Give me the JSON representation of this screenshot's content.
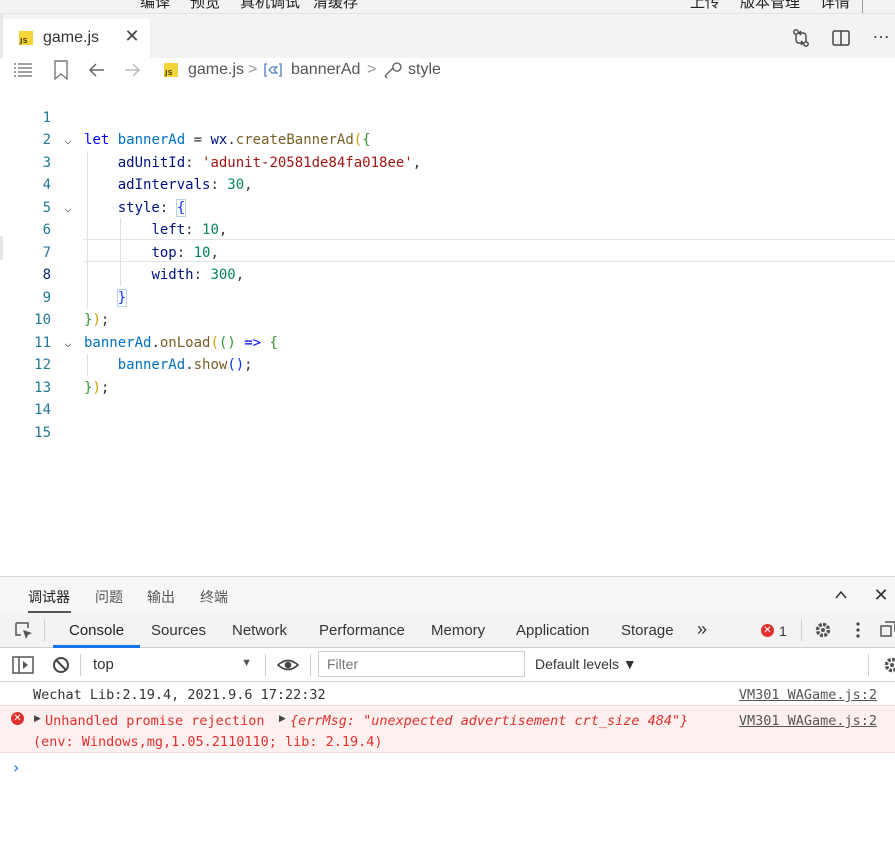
{
  "top_toolbar": {
    "items": [
      "编译",
      "预览",
      "真机调试",
      "清缓存",
      "上传",
      "版本管理",
      "详情"
    ]
  },
  "tab": {
    "badge": "JS",
    "label": "game.js",
    "close": "✕"
  },
  "tab_actions": {
    "compare_icon": "compare-changes-icon",
    "split_icon": "split-editor-icon",
    "more": "…"
  },
  "breadcrumb": {
    "file": "game.js",
    "sep": ">",
    "symbol": "bannerAd",
    "property": "style"
  },
  "editor": {
    "line_numbers": [
      "1",
      "2",
      "3",
      "4",
      "5",
      "6",
      "7",
      "8",
      "9",
      "10",
      "11",
      "12",
      "13",
      "14",
      "15"
    ],
    "current_line": 8,
    "lines": [
      "",
      "",
      "let bannerAd = wx.createBannerAd({",
      "    adUnitId: 'adunit-20581de84fa018ee',",
      "    adIntervals: 30,",
      "    style: {",
      "        left: 10,",
      "        top: 10,",
      "        width: 300,",
      "    }",
      "});",
      "bannerAd.onLoad(() => {",
      "    bannerAd.show();",
      "});",
      ""
    ]
  },
  "panel": {
    "tabs": [
      "调试器",
      "问题",
      "输出",
      "终端"
    ],
    "active_tab": "调试器",
    "collapse": "︿",
    "close": "✕"
  },
  "devtools": {
    "tabs": [
      "Console",
      "Sources",
      "Network",
      "Performance",
      "Memory",
      "Application",
      "Storage"
    ],
    "active_tab": "Console",
    "more": "»",
    "error_count": "1"
  },
  "console_toolbar": {
    "context": "top",
    "filter_placeholder": "Filter",
    "levels": "Default levels ▼"
  },
  "console": {
    "info_line": "Wechat Lib:2.19.4, 2021.9.6 17:22:32",
    "info_source": "VM301 WAGame.js:2",
    "error_prefix": "Unhandled promise rejection",
    "error_obj": "{errMsg: \"unexpected advertisement crt_size 484\"}",
    "error_env": "(env: Windows,mg,1.05.2110110; lib: 2.19.4)",
    "error_source": "VM301 WAGame.js:2",
    "prompt": "›"
  },
  "colors": {
    "accent": "#1a73e8",
    "error": "#e0312f",
    "error_bg": "#fff0f0"
  }
}
